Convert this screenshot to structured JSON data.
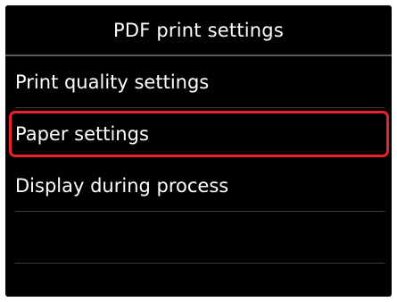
{
  "title": "PDF print settings",
  "menu": {
    "items": [
      {
        "label": "Print quality settings",
        "selected": false
      },
      {
        "label": "Paper settings",
        "selected": true
      },
      {
        "label": "Display during process",
        "selected": false
      },
      {
        "label": "",
        "selected": false
      },
      {
        "label": "",
        "selected": false
      }
    ]
  },
  "colors": {
    "background": "#000000",
    "text": "#ffffff",
    "selection_border": "#e8222a",
    "divider": "#3c3c3c"
  }
}
